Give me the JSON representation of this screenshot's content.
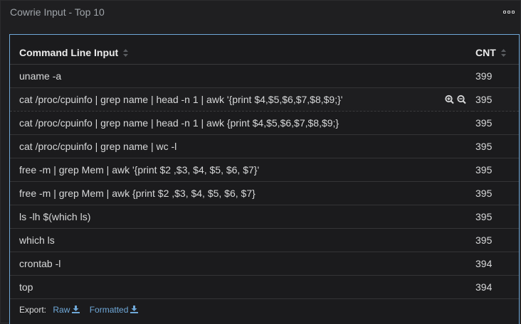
{
  "panel": {
    "title": "Cowrie Input - Top 10",
    "menu_icon": "ellipsis-icon"
  },
  "table": {
    "columns": [
      "Command Line Input",
      "CNT"
    ],
    "rows": [
      {
        "command": "uname -a",
        "count": "399"
      },
      {
        "command": "cat /proc/cpuinfo | grep name | head -n 1 | awk '{print $4,$5,$6,$7,$8,$9;}'",
        "count": "395"
      },
      {
        "command": "cat /proc/cpuinfo | grep name | head -n 1 | awk {print $4,$5,$6,$7,$8,$9;}",
        "count": "395"
      },
      {
        "command": "cat /proc/cpuinfo | grep name | wc -l",
        "count": "395"
      },
      {
        "command": "free -m | grep Mem | awk '{print $2 ,$3, $4, $5, $6, $7}'",
        "count": "395"
      },
      {
        "command": "free -m | grep Mem | awk {print $2 ,$3, $4, $5, $6, $7}",
        "count": "395"
      },
      {
        "command": "ls -lh $(which ls)",
        "count": "395"
      },
      {
        "command": "which ls",
        "count": "395"
      },
      {
        "command": "crontab -l",
        "count": "394"
      },
      {
        "command": "top",
        "count": "394"
      }
    ],
    "hovered_row_index": 1,
    "row_action_icons": [
      "zoom-in-icon",
      "zoom-out-icon"
    ]
  },
  "export": {
    "label": "Export:",
    "raw_label": "Raw",
    "formatted_label": "Formatted",
    "icon": "download-icon"
  },
  "colors": {
    "accent": "#6fa8d8",
    "background": "#1f1f21",
    "text": "#d8d9da"
  }
}
